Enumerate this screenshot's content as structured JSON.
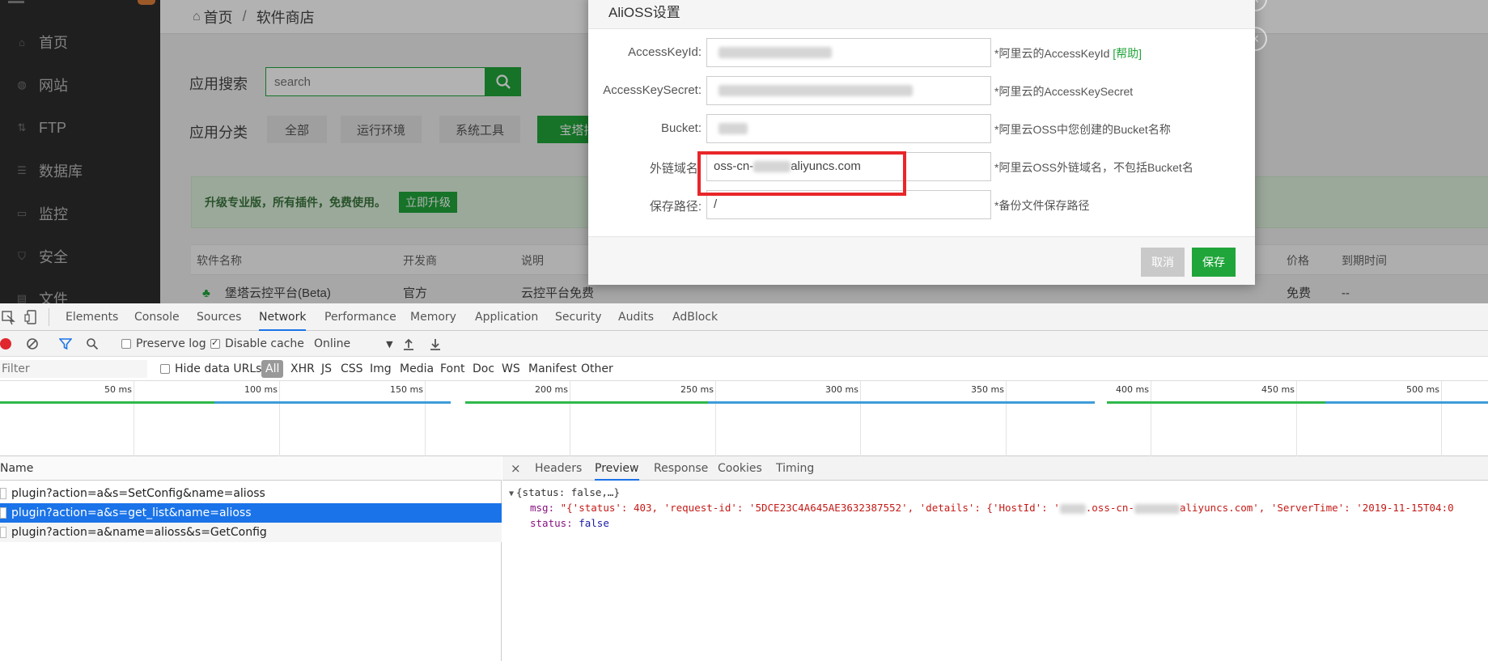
{
  "app": {
    "sidebar": {
      "items": [
        {
          "label": "首页",
          "icon": "home-icon"
        },
        {
          "label": "网站",
          "icon": "globe-icon"
        },
        {
          "label": "FTP",
          "icon": "ftp-icon"
        },
        {
          "label": "数据库",
          "icon": "database-icon"
        },
        {
          "label": "监控",
          "icon": "monitor-icon"
        },
        {
          "label": "安全",
          "icon": "shield-icon"
        },
        {
          "label": "文件",
          "icon": "folder-icon"
        }
      ]
    },
    "breadcrumb": {
      "home": "首页",
      "separator": "/",
      "current": "软件商店"
    },
    "search": {
      "label": "应用搜索",
      "placeholder": "search"
    },
    "categories": {
      "label": "应用分类",
      "items": [
        "全部",
        "运行环境",
        "系统工具",
        "宝塔插"
      ],
      "active_index": 3
    },
    "upgrade_banner": {
      "text": "升级专业版，所有插件，免费使用。",
      "button": "立即升级"
    },
    "table": {
      "headers": [
        "软件名称",
        "开发商",
        "说明",
        "价格",
        "到期时间"
      ],
      "rows": [
        {
          "name": "堡塔云控平台(Beta)",
          "developer": "官方",
          "desc": "云控平台免费",
          "price": "免费",
          "expiry": "--"
        }
      ]
    },
    "accent_color": "#20a53a"
  },
  "modal": {
    "title": "AliOSS设置",
    "fields": [
      {
        "label": "AccessKeyId:",
        "value": "",
        "hint": "*阿里云的AccessKeyId",
        "hint_link": "[帮助]"
      },
      {
        "label": "AccessKeySecret:",
        "value": "",
        "hint": "*阿里云的AccessKeySecret"
      },
      {
        "label": "Bucket:",
        "value": "",
        "hint": "*阿里云OSS中您创建的Bucket名称"
      },
      {
        "label": "外链域名:",
        "value_prefix": "oss-cn-",
        "value_suffix": "aliyuncs.com",
        "hint": "*阿里云OSS外链域名，不包括Bucket名"
      },
      {
        "label": "保存路径:",
        "value": "/",
        "hint": "*备份文件保存路径"
      }
    ],
    "buttons": {
      "cancel": "取消",
      "save": "保存"
    }
  },
  "devtools": {
    "tabs": [
      "Elements",
      "Console",
      "Sources",
      "Network",
      "Performance",
      "Memory",
      "Application",
      "Security",
      "Audits",
      "AdBlock"
    ],
    "active_tab": "Network",
    "toolbar": {
      "preserve_log": "Preserve log",
      "disable_cache": "Disable cache",
      "throttle": "Online"
    },
    "filter": {
      "placeholder": "Filter",
      "hide_data_urls": "Hide data URLs",
      "types": [
        "All",
        "XHR",
        "JS",
        "CSS",
        "Img",
        "Media",
        "Font",
        "Doc",
        "WS",
        "Manifest",
        "Other"
      ]
    },
    "timeline_ticks": [
      "50 ms",
      "100 ms",
      "150 ms",
      "200 ms",
      "250 ms",
      "300 ms",
      "350 ms",
      "400 ms",
      "450 ms",
      "500 ms"
    ],
    "requests": {
      "header": "Name",
      "items": [
        "plugin?action=a&s=SetConfig&name=alioss",
        "plugin?action=a&s=get_list&name=alioss",
        "plugin?action=a&name=alioss&s=GetConfig"
      ],
      "selected_index": 1
    },
    "detail_tabs": [
      "Headers",
      "Preview",
      "Response",
      "Cookies",
      "Timing"
    ],
    "active_detail_tab": "Preview",
    "preview": {
      "summary": "{status: false,…}",
      "msg_key": "msg:",
      "msg_value_a": "\"{'status': 403, 'request-id': '5DCE23C4A645AE3632387552', 'details': {'HostId': '",
      "msg_value_b": ".oss-cn-",
      "msg_value_c": "aliyuncs.com', 'ServerTime': '2019-11-15T04:0",
      "status_key": "status:",
      "status_value": "false"
    }
  }
}
